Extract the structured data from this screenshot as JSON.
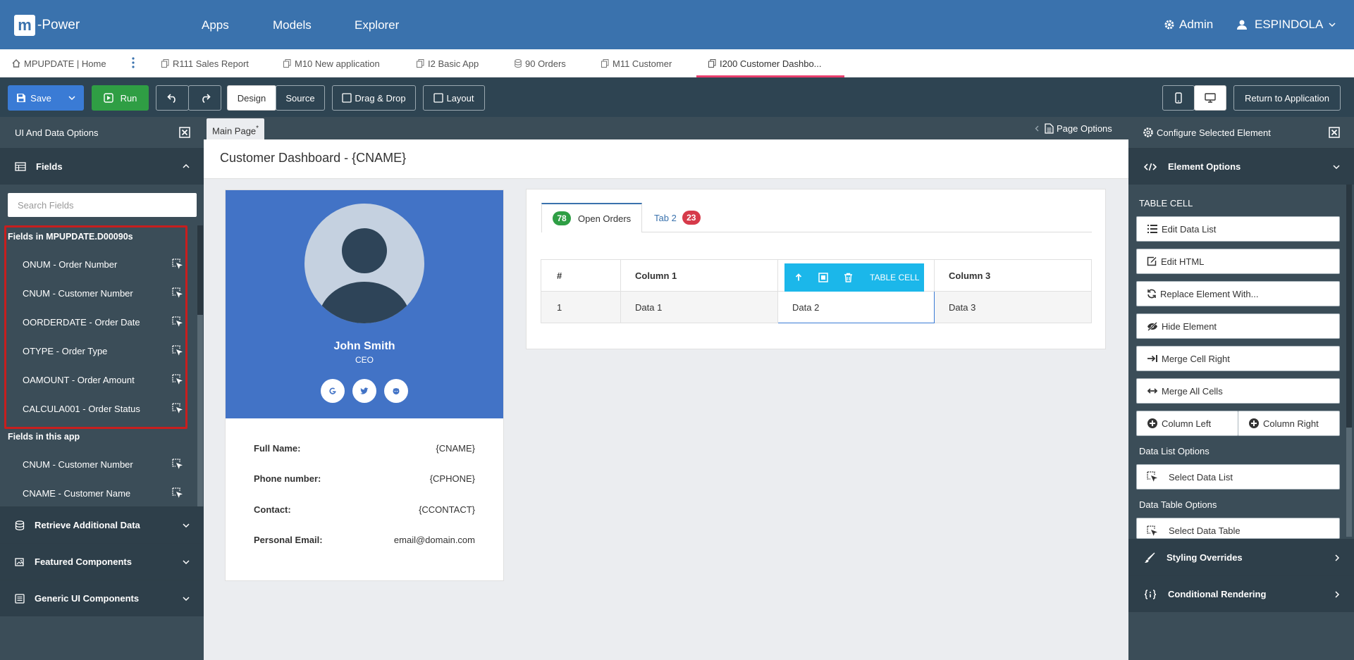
{
  "topbar": {
    "logo_m": "m",
    "logo_rest": "-Power",
    "nav": [
      "Apps",
      "Models",
      "Explorer"
    ],
    "admin_label": "Admin",
    "user_label": "ESPINDOLA"
  },
  "app_tabs": [
    {
      "label": "MPUPDATE | Home",
      "icon": "home-icon"
    },
    {
      "label": "R111 Sales Report",
      "icon": "copy-icon"
    },
    {
      "label": "M10 New application",
      "icon": "copy-icon"
    },
    {
      "label": "I2 Basic App",
      "icon": "copy-icon"
    },
    {
      "label": "90 Orders",
      "icon": "database-icon"
    },
    {
      "label": "M11 Customer",
      "icon": "copy-icon"
    },
    {
      "label": "I200 Customer Dashbo...",
      "icon": "copy-icon",
      "active": true
    }
  ],
  "toolbar": {
    "save_label": "Save",
    "run_label": "Run",
    "design_label": "Design",
    "source_label": "Source",
    "drag_drop_label": "Drag & Drop",
    "layout_label": "Layout",
    "return_label": "Return to Application"
  },
  "left_panel": {
    "title": "UI And Data Options",
    "fields_header": "Fields",
    "search_placeholder": "Search Fields",
    "group1_title": "Fields in MPUPDATE.D00090s",
    "group1_fields": [
      "ONUM - Order Number",
      "CNUM - Customer Number",
      "OORDERDATE - Order Date",
      "OTYPE - Order Type",
      "OAMOUNT - Order Amount",
      "CALCULA001 - Order Status"
    ],
    "group2_title": "Fields in this app",
    "group2_fields": [
      "CNUM - Customer Number",
      "CNAME - Customer Name"
    ],
    "accordions": [
      "Retrieve Additional Data",
      "Featured Components",
      "Generic UI Components"
    ]
  },
  "canvas": {
    "main_page_tab": "Main Page",
    "main_page_marker": "*",
    "page_options": "Page Options",
    "page_title": "Customer Dashboard - {CNAME}",
    "profile": {
      "name": "John Smith",
      "role": "CEO",
      "info": [
        {
          "label": "Full Name:",
          "value": "{CNAME}"
        },
        {
          "label": "Phone number:",
          "value": "{CPHONE}"
        },
        {
          "label": "Contact:",
          "value": "{CCONTACT}"
        },
        {
          "label": "Personal Email:",
          "value": "email@domain.com"
        }
      ]
    },
    "tabs": [
      {
        "badge": "78",
        "label": "Open Orders",
        "badge_color": "#2e9e44"
      },
      {
        "badge": "23",
        "label": "Tab 2",
        "badge_color": "#d63a4a"
      }
    ],
    "table": {
      "headers": [
        "#",
        "Column 1",
        "",
        "Column 3"
      ],
      "row": [
        "1",
        "Data 1",
        "Data 2",
        "Data 3"
      ]
    },
    "cell_toolbar_label": "TABLE CELL"
  },
  "right_panel": {
    "title": "Configure Selected Element",
    "element_options": "Element Options",
    "section_label": "TABLE CELL",
    "buttons": [
      "Edit Data List",
      "Edit HTML",
      "Replace Element With...",
      "Hide Element",
      "Merge Cell Right",
      "Merge All Cells"
    ],
    "column_left": "Column Left",
    "column_right": "Column Right",
    "data_list_options": "Data List Options",
    "select_data_list": "Select Data List",
    "data_table_options": "Data Table Options",
    "select_data_table": "Select Data Table",
    "styling_overrides": "Styling Overrides",
    "conditional_rendering": "Conditional Rendering"
  },
  "colors": {
    "topbar": "#3a72ad",
    "toolbar": "#2e4452",
    "panel": "#3b4d58",
    "save": "#3a7bd5",
    "run": "#2f9e44",
    "profile": "#4273c6",
    "active_tab_underline": "#e83e6c",
    "cell_toolbar": "#1bb7ea"
  }
}
